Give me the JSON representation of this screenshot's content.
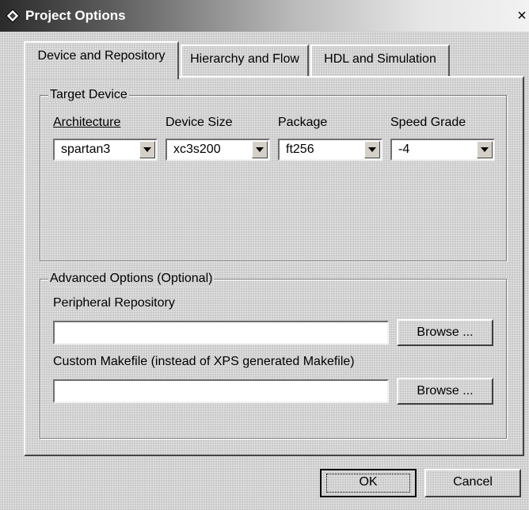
{
  "window": {
    "title": "Project Options",
    "close_glyph": "×",
    "icon": "diamond-icon"
  },
  "tabs": [
    {
      "label": "Device and Repository",
      "active": true
    },
    {
      "label": "Hierarchy and Flow",
      "active": false
    },
    {
      "label": "HDL and Simulation",
      "active": false
    }
  ],
  "target_device": {
    "title": "Target Device",
    "architecture": {
      "label": "Architecture",
      "value": "spartan3"
    },
    "device_size": {
      "label": "Device Size",
      "value": "xc3s200"
    },
    "package": {
      "label": "Package",
      "value": "ft256"
    },
    "speed_grade": {
      "label": "Speed Grade",
      "value": "-4"
    }
  },
  "advanced": {
    "title": "Advanced Options (Optional)",
    "peripheral_repository": {
      "label": "Peripheral Repository",
      "value": "",
      "browse": "Browse ..."
    },
    "custom_makefile": {
      "label": "Custom Makefile (instead of XPS generated Makefile)",
      "value": "",
      "browse": "Browse ..."
    }
  },
  "buttons": {
    "ok": "OK",
    "cancel": "Cancel"
  }
}
